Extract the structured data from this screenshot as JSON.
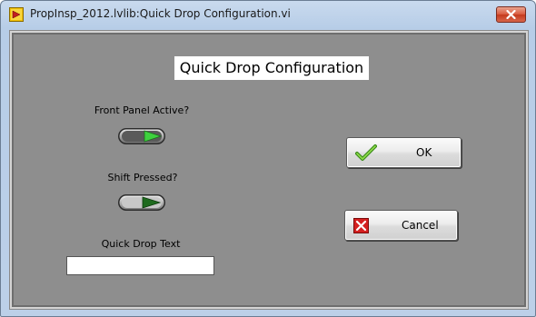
{
  "window": {
    "title": "PropInsp_2012.lvlib:Quick Drop Configuration.vi"
  },
  "panel": {
    "heading": "Quick Drop Configuration",
    "front_panel_active": {
      "label": "Front Panel Active?",
      "state": "on"
    },
    "shift_pressed": {
      "label": "Shift Pressed?",
      "state": "off"
    },
    "quick_drop_text": {
      "label": "Quick Drop Text",
      "value": ""
    },
    "ok_button": {
      "label": "OK",
      "icon": "checkmark-icon"
    },
    "cancel_button": {
      "label": "Cancel",
      "icon": "red-x-icon"
    }
  },
  "colors": {
    "panel_background": "#8e8e8e",
    "led_on": "#3ed13e",
    "led_off": "#1f6b1f"
  }
}
